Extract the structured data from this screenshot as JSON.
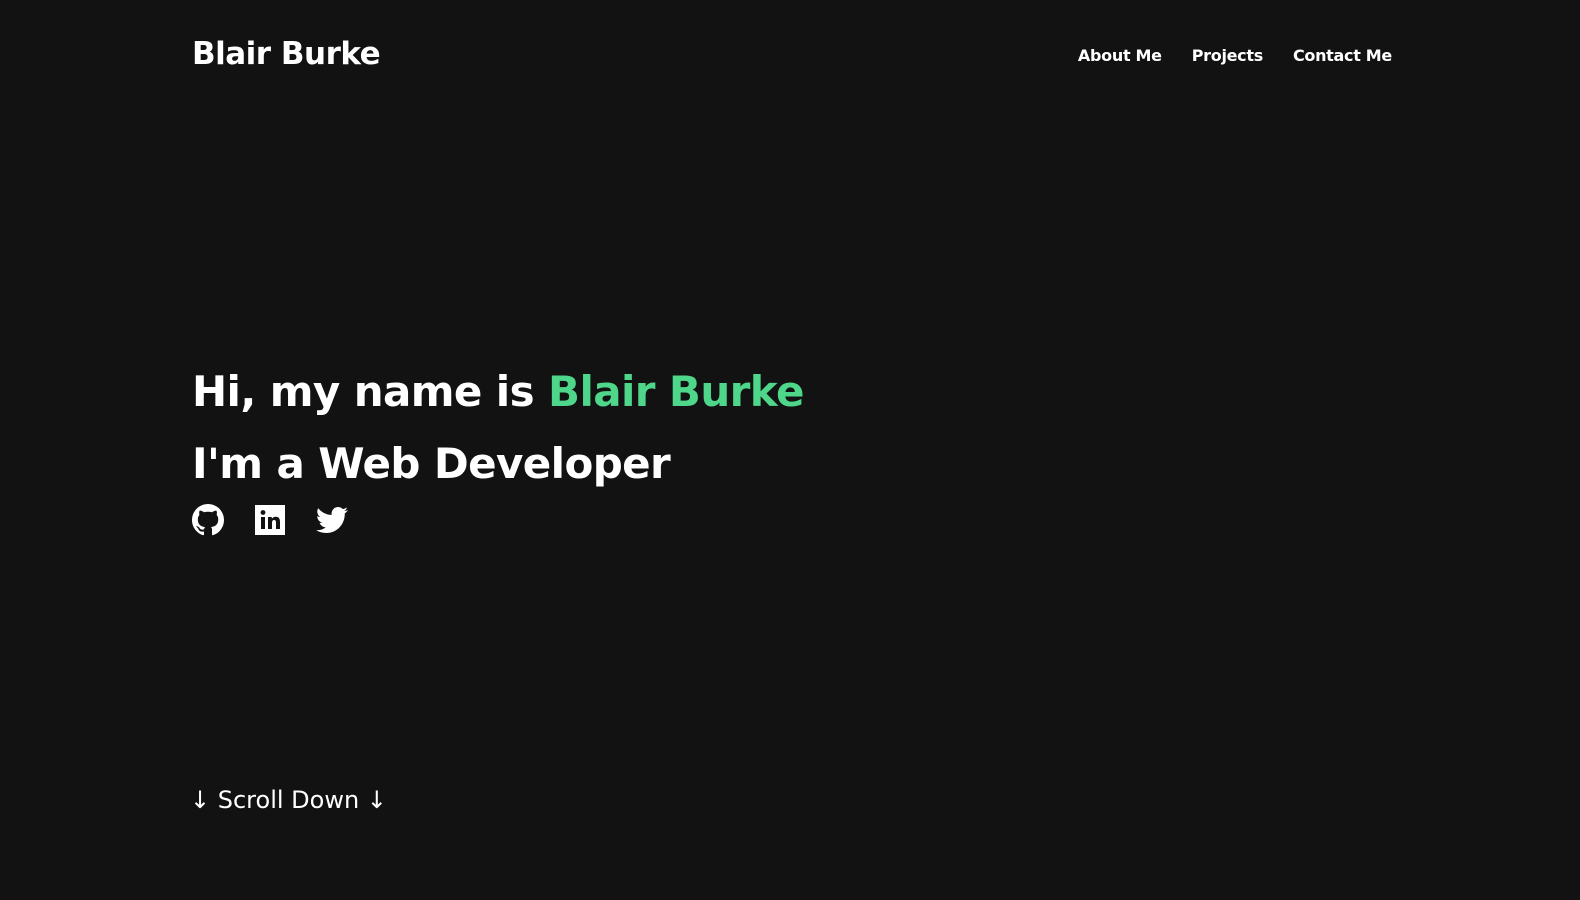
{
  "header": {
    "logo": "Blair Burke",
    "nav": [
      "About Me",
      "Projects",
      "Contact Me"
    ]
  },
  "hero": {
    "greeting_prefix": "Hi, my name is ",
    "name": "Blair Burke",
    "role": "I'm a Web Developer"
  },
  "social": {
    "icons": [
      "github-icon",
      "linkedin-icon",
      "twitter-icon"
    ]
  },
  "scroll_hint": "↓ Scroll Down ↓",
  "colors": {
    "background": "#121212",
    "text": "#ffffff",
    "accent": "#4ed68a"
  }
}
